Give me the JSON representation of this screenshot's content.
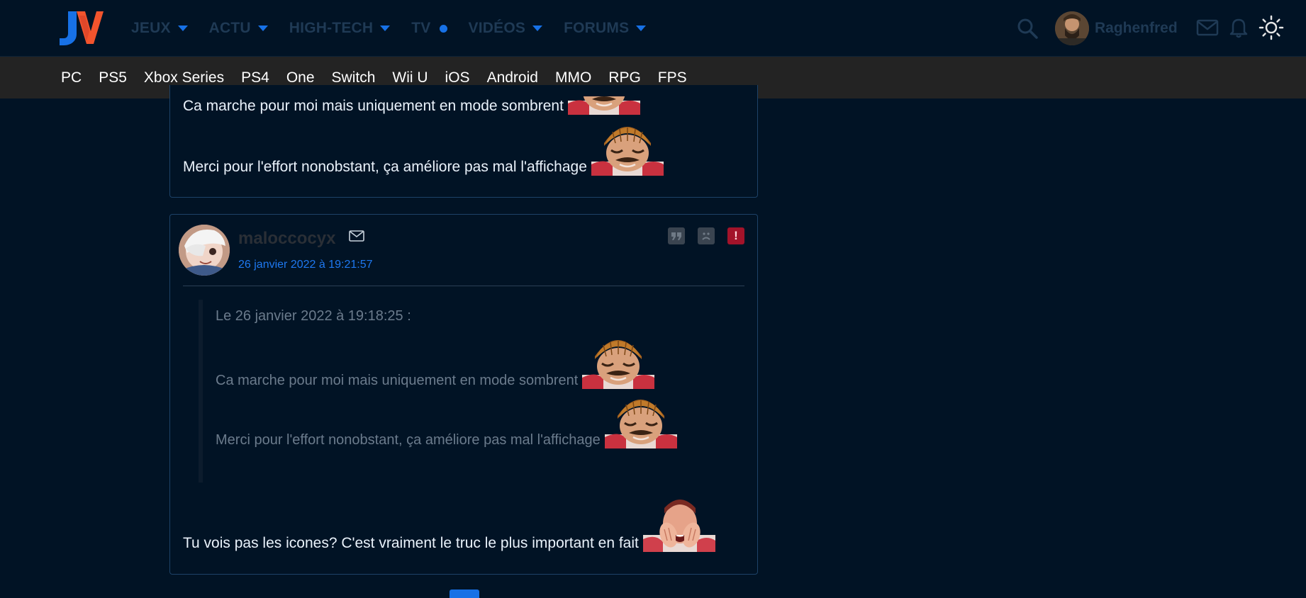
{
  "header": {
    "nav": [
      {
        "label": "JEUX",
        "marker": "caret"
      },
      {
        "label": "ACTU",
        "marker": "caret"
      },
      {
        "label": "HIGH-TECH",
        "marker": "caret"
      },
      {
        "label": "TV",
        "marker": "dot"
      },
      {
        "label": "VIDÉOS",
        "marker": "caret"
      },
      {
        "label": "FORUMS",
        "marker": "caret"
      }
    ],
    "username": "Raghenfred",
    "accent_color": "#1771e6",
    "icons": [
      "search-icon",
      "avatar",
      "mail-icon",
      "bell-icon",
      "sun-icon"
    ]
  },
  "subnav": [
    "PC",
    "PS5",
    "Xbox Series",
    "PS4",
    "One",
    "Switch",
    "Wii U",
    "iOS",
    "Android",
    "MMO",
    "RPG",
    "FPS"
  ],
  "post_top": {
    "line1": "Ca marche pour moi mais uniquement en mode sombrent",
    "line2": "Merci pour l'effort nonobstant, ça améliore pas mal l'affichage"
  },
  "post_main": {
    "author": "maloccocyx",
    "date": "26 janvier 2022 à 19:21:57",
    "quote": {
      "header": "Le 26 janvier 2022 à 19:18:25 :",
      "line1": "Ca marche pour moi mais uniquement en mode sombrent",
      "line2": "Merci pour l'effort nonobstant, ça améliore pas mal l'affichage"
    },
    "body": "Tu vois pas les icones? C'est vraiment le truc le plus important en fait",
    "actions": [
      "quote-icon",
      "sad-face-icon",
      "report-icon"
    ],
    "report_glyph": "!"
  }
}
